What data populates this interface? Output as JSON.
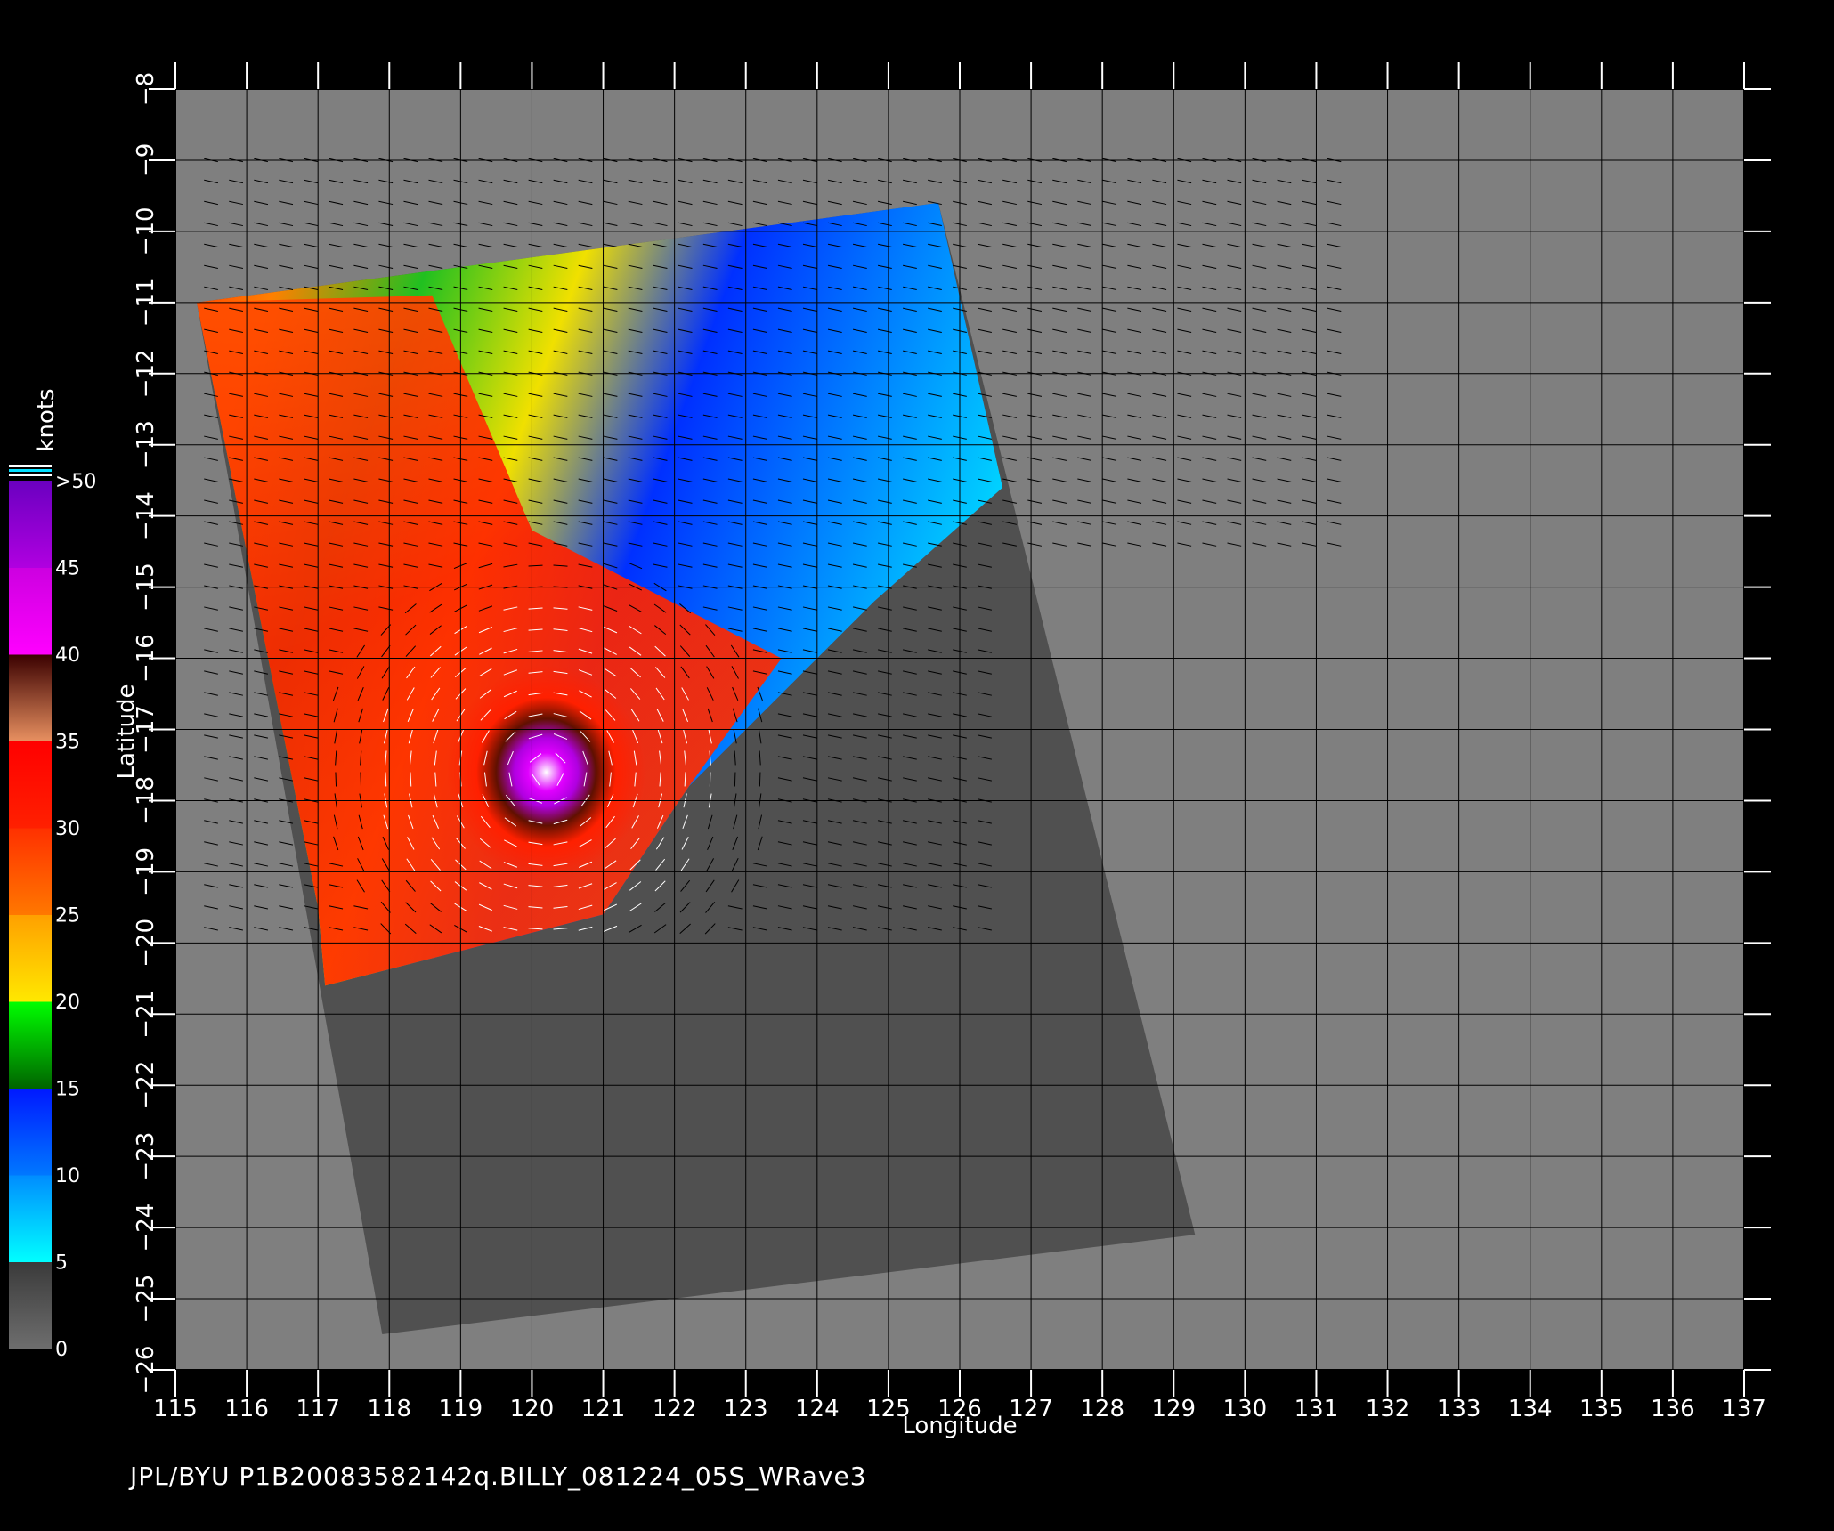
{
  "chart_data": {
    "type": "heatmap",
    "title": "",
    "xlabel": "Longitude",
    "ylabel": "Latitude",
    "xlim": [
      115,
      137
    ],
    "ylim": [
      -26,
      -8
    ],
    "x_ticks": [
      115,
      116,
      117,
      118,
      119,
      120,
      121,
      122,
      123,
      124,
      125,
      126,
      127,
      128,
      129,
      130,
      131,
      132,
      133,
      134,
      135,
      136,
      137
    ],
    "y_ticks": [
      -8,
      -9,
      -10,
      -11,
      -12,
      -13,
      -14,
      -15,
      -16,
      -17,
      -18,
      -19,
      -20,
      -21,
      -22,
      -23,
      -24,
      -25,
      -26
    ],
    "grid": true,
    "colorbar": {
      "label": "knots",
      "placement": "left",
      "tick_labels": [
        "0",
        "5",
        "10",
        "15",
        "20",
        "25",
        "30",
        "35",
        "40",
        "45",
        ">50"
      ],
      "bins": [
        {
          "from": 0,
          "to": 5,
          "colors": [
            "#6e6e6e",
            "#3a3a3a"
          ]
        },
        {
          "from": 5,
          "to": 10,
          "colors": [
            "#00ffff",
            "#008cff"
          ]
        },
        {
          "from": 10,
          "to": 15,
          "colors": [
            "#0078ff",
            "#0018ff"
          ]
        },
        {
          "from": 15,
          "to": 20,
          "colors": [
            "#006400",
            "#00ff00"
          ]
        },
        {
          "from": 20,
          "to": 25,
          "colors": [
            "#ffe800",
            "#ffa000"
          ]
        },
        {
          "from": 25,
          "to": 30,
          "colors": [
            "#ff7800",
            "#ff3000"
          ]
        },
        {
          "from": 30,
          "to": 35,
          "colors": [
            "#ff2000",
            "#ff0000"
          ]
        },
        {
          "from": 35,
          "to": 40,
          "colors": [
            "#e89060",
            "#3a0000"
          ]
        },
        {
          "from": 40,
          "to": 45,
          "colors": [
            "#ff00ff",
            "#cc00e0"
          ]
        },
        {
          "from": 45,
          "to": 50,
          "colors": [
            "#b000e0",
            "#6a00c0"
          ]
        }
      ]
    },
    "swath_outline": [
      [
        115.3,
        -11.0
      ],
      [
        125.7,
        -9.6
      ],
      [
        129.3,
        -24.1
      ],
      [
        117.9,
        -25.5
      ]
    ],
    "data_region_outline": [
      [
        115.3,
        -11.0
      ],
      [
        125.7,
        -9.6
      ],
      [
        126.6,
        -13.6
      ],
      [
        124.8,
        -15.2
      ],
      [
        122.2,
        -17.8
      ],
      [
        121.0,
        -19.6
      ],
      [
        117.1,
        -20.6
      ],
      [
        117.0,
        -19.5
      ]
    ],
    "storm": {
      "name": "BILLY",
      "center": [
        120.2,
        -17.6
      ],
      "max_wind_bin": "40-45"
    }
  },
  "footer": {
    "text": "JPL/BYU  P1B20083582142q.BILLY_081224_05S_WRave3"
  },
  "colors": {
    "background": "#000000",
    "plot_area": "#7f7f7f",
    "no_data_swath": "#505050",
    "grid": "#000000",
    "axis_text": "#ffffff"
  }
}
